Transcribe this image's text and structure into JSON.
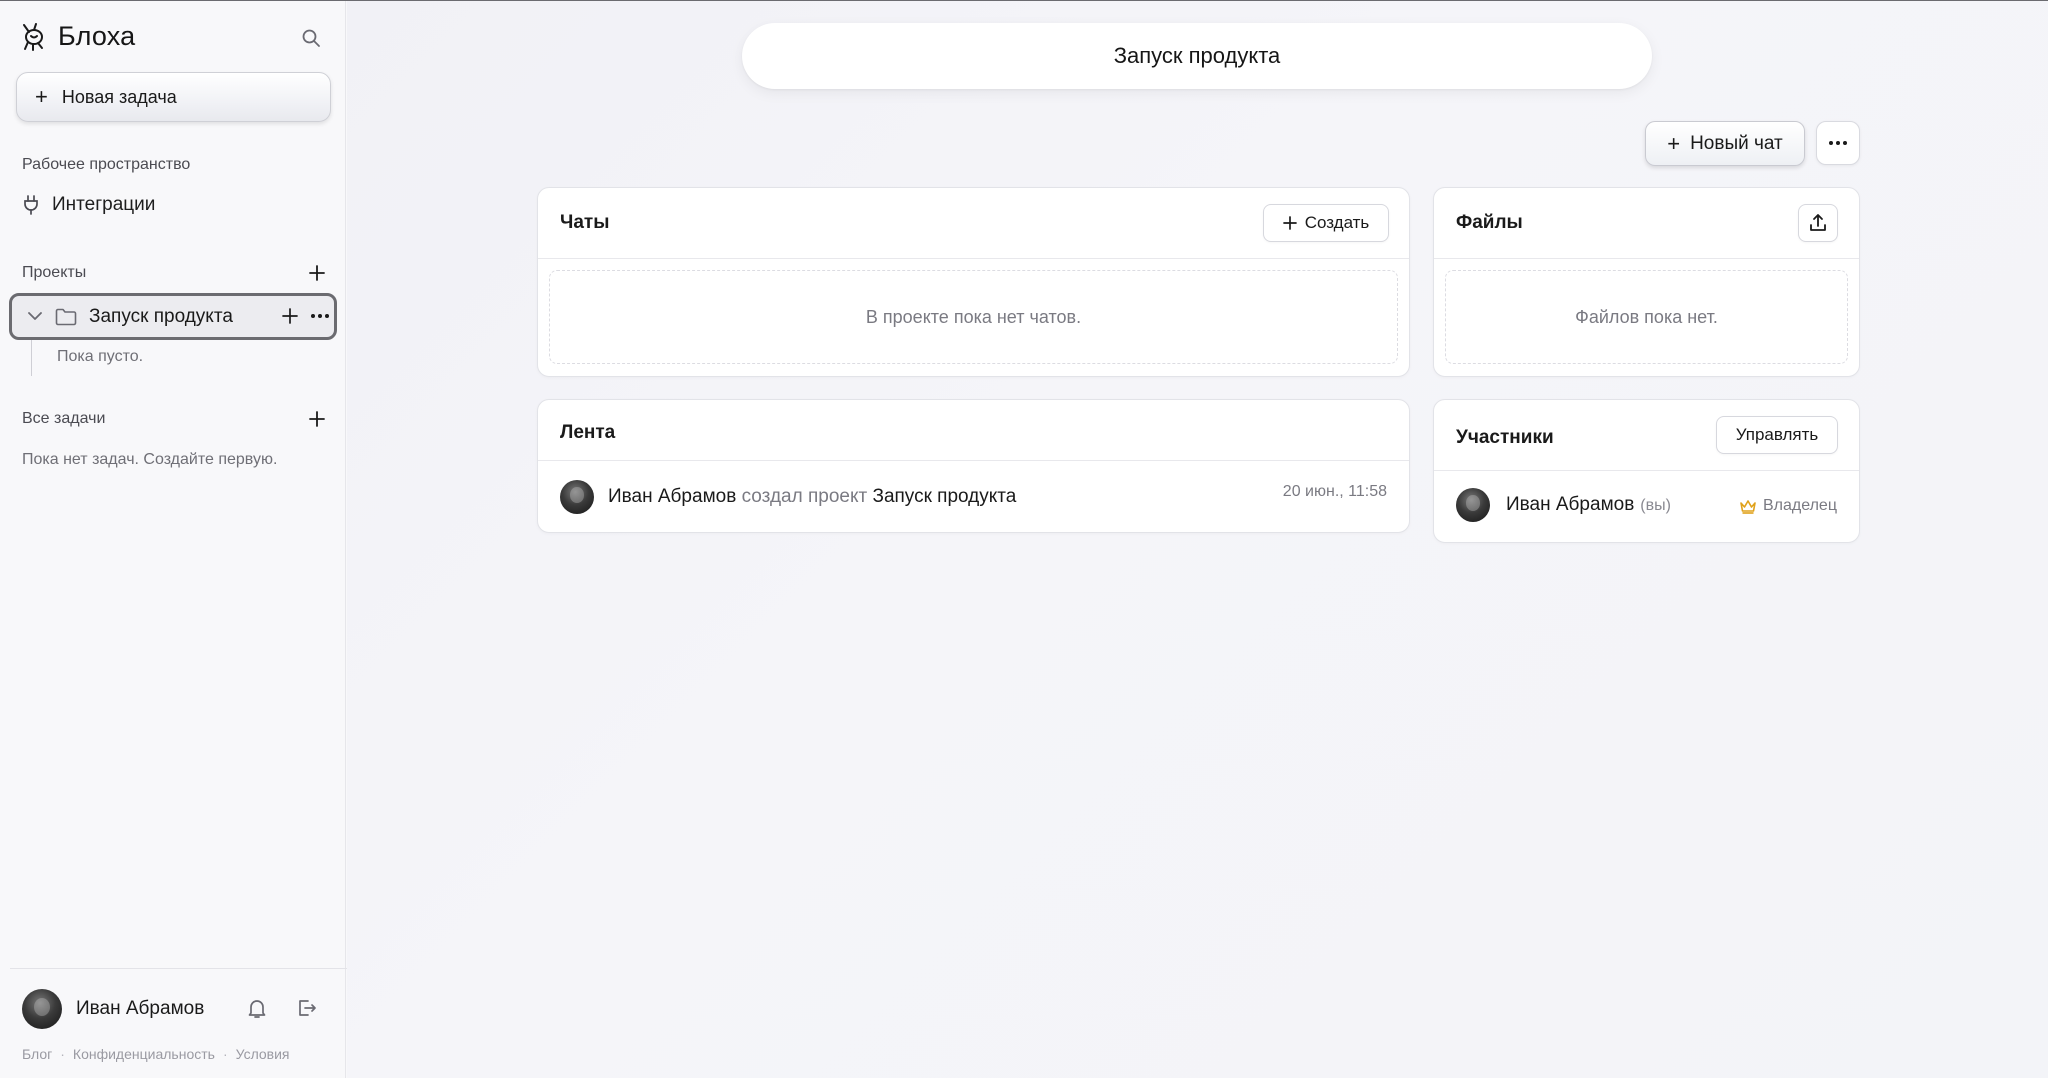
{
  "sidebar": {
    "brand": "Блоха",
    "new_task_label": "Новая задача",
    "workspace_label": "Рабочее пространство",
    "integrations_label": "Интеграции",
    "projects_label": "Проекты",
    "project": {
      "name": "Запуск продукта",
      "empty_text": "Пока пусто."
    },
    "all_tasks_label": "Все задачи",
    "no_tasks_text": "Пока нет задач. Создайте первую.",
    "user_name": "Иван Абрамов",
    "footer": {
      "blog": "Блог",
      "privacy": "Конфиденциальность",
      "terms": "Условия",
      "separator": "·"
    }
  },
  "main": {
    "title": "Запуск продукта",
    "new_chat_label": "Новый чат",
    "chats": {
      "title": "Чаты",
      "create_label": "Создать",
      "empty_text": "В проекте пока нет чатов."
    },
    "files": {
      "title": "Файлы",
      "empty_text": "Файлов пока нет."
    },
    "feed": {
      "title": "Лента",
      "item": {
        "user": "Иван Абрамов",
        "action": "создал проект",
        "target": "Запуск продукта",
        "time": "20 июн., 11:58"
      }
    },
    "members": {
      "title": "Участники",
      "manage_label": "Управлять",
      "member": {
        "name": "Иван Абрамов",
        "you": "(вы)",
        "role": "Владелец"
      }
    }
  },
  "icons": {
    "logo": "flea-logo-icon",
    "search": "search-icon",
    "plus": "plus-icon",
    "plug": "plug-icon",
    "chevron": "chevron-down-icon",
    "folder": "folder-icon",
    "more": "more-horizontal-icon",
    "bell": "bell-icon",
    "logout": "logout-icon",
    "upload": "upload-icon",
    "crown": "crown-icon"
  },
  "colors": {
    "accent_crown": "#e0a21b",
    "focus_border": "#6b6b70"
  }
}
